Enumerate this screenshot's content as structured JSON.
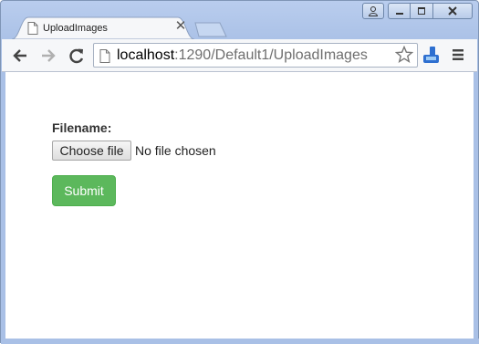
{
  "browser": {
    "tab_title": "UploadImages",
    "tab_close_glyph": "✕",
    "url_host": "localhost",
    "url_path": ":1290/Default1/UploadImages"
  },
  "form": {
    "filename_label": "Filename:",
    "choose_file_label": "Choose file",
    "file_status": "No file chosen",
    "submit_label": "Submit"
  },
  "icons": [
    "document-icon",
    "back-arrow-icon",
    "forward-arrow-icon",
    "reload-icon",
    "page-icon",
    "star-icon",
    "extension-icon",
    "menu-icon",
    "user-icon",
    "minimize-icon",
    "restore-icon",
    "close-icon"
  ],
  "colors": {
    "window_frame": "#a9c0e6",
    "submit_bg": "#5cb85c",
    "submit_text": "#ffffff",
    "url_path": "#6f6f6f"
  }
}
